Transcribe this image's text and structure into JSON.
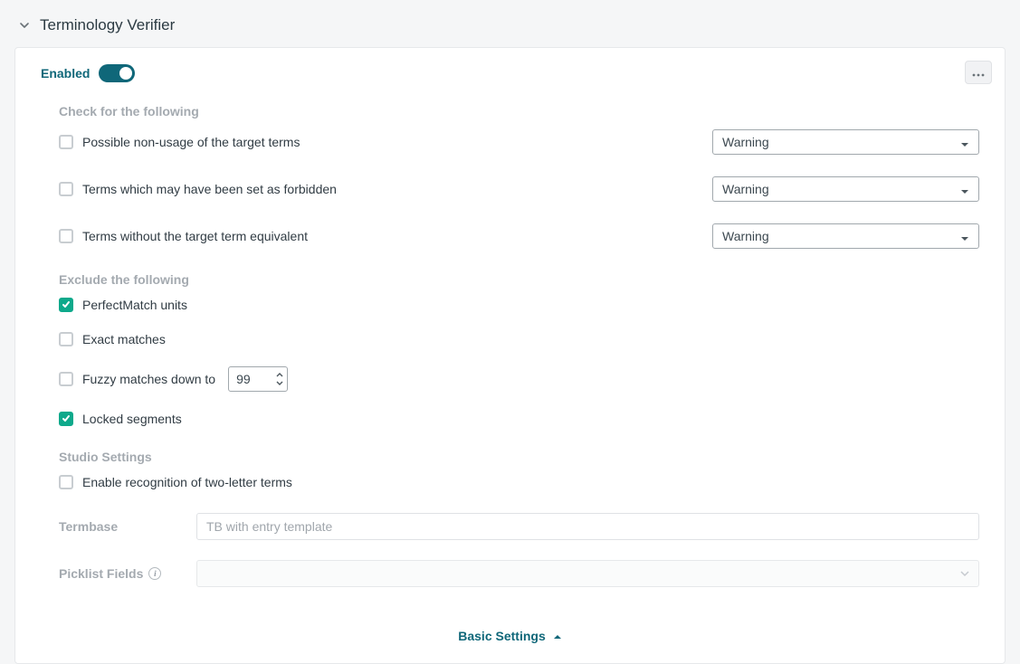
{
  "section": {
    "title": "Terminology Verifier"
  },
  "enabled": {
    "label": "Enabled",
    "on": true
  },
  "groups": {
    "check": {
      "label": "Check for the following"
    },
    "exclude": {
      "label": "Exclude the following"
    },
    "studio": {
      "label": "Studio Settings"
    }
  },
  "checks": {
    "nonusage": {
      "label": "Possible non-usage of the target terms",
      "severity": "Warning"
    },
    "forbidden": {
      "label": "Terms which may have been set as forbidden",
      "severity": "Warning"
    },
    "noequiv": {
      "label": "Terms without the target term equivalent",
      "severity": "Warning"
    }
  },
  "exclude": {
    "perfectmatch": {
      "label": "PerfectMatch units",
      "checked": true
    },
    "exact": {
      "label": "Exact matches",
      "checked": false
    },
    "fuzzy": {
      "label": "Fuzzy matches down to",
      "checked": false,
      "value": "99"
    },
    "locked": {
      "label": "Locked segments",
      "checked": true
    }
  },
  "studio": {
    "twoletter": {
      "label": "Enable recognition of two-letter terms",
      "checked": false
    }
  },
  "form": {
    "termbase": {
      "label": "Termbase",
      "placeholder": "TB with entry template",
      "value": ""
    },
    "picklist": {
      "label": "Picklist Fields"
    }
  },
  "footer": {
    "label": "Basic Settings"
  }
}
